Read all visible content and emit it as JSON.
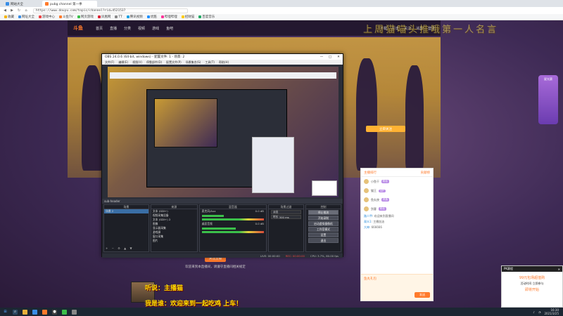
{
  "browser": {
    "tabs": [
      {
        "label": "网站大全"
      },
      {
        "label": "pubg channel 第一季"
      }
    ],
    "url": "https://www.douyu.com/topic/channel?rid=4521537",
    "bookmarks": [
      "收藏",
      "网址大全",
      "游戏中心",
      "斗鱼TV",
      "网页游戏",
      "凤凰网",
      "TT",
      "腾讯视频",
      "优酷",
      "哔哩哔哩",
      "招财猫",
      "百度音乐"
    ]
  },
  "site": {
    "logo": "斗鱼",
    "nav": [
      "首页",
      "直播",
      "分类",
      "视频",
      "游戏",
      "鱼吧"
    ],
    "header_right": [
      "下载",
      "历史",
      "关注",
      "消息",
      "登录"
    ],
    "banner_text": "上周猫喵头推哦第一人名言"
  },
  "obs": {
    "title": "OBS 24.0.6 (64-bit, windows) - 配置文件: 1 - 场景: 2",
    "menu": [
      "文件(F)",
      "编辑(E)",
      "视图(V)",
      "停靠部件(D)",
      "配置文件(P)",
      "场景集合(S)",
      "工具(T)",
      "帮助(H)"
    ],
    "dock_header_items": [
      "sub-header",
      "混音器",
      "场景"
    ],
    "scenes": {
      "title": "场景",
      "items": [
        "场景 2"
      ]
    },
    "sources": {
      "title": "来源",
      "items": [
        "文本 (GDI+)",
        "视频采集设备",
        "文本 (GDI+) 2",
        "图像",
        "显示器采集",
        "游戏源",
        "窗口采集",
        "图片"
      ]
    },
    "mixer": {
      "title": "混音器",
      "channels": [
        {
          "name": "麦克风/Aux",
          "db": "0.0 dB",
          "level": 0.35
        },
        {
          "name": "桌面音频",
          "db": "0.0 dB",
          "level": 0.55
        }
      ]
    },
    "transitions": {
      "title": "场景过渡",
      "type": "淡出",
      "duration_label": "时长",
      "duration": "300 ms"
    },
    "controls": {
      "title": "控制",
      "buttons": [
        "停止推流",
        "开始录制",
        "启动虚拟摄像机",
        "工作室模式",
        "设置",
        "退出"
      ]
    },
    "status": {
      "live": "LIVE: 00:00:00",
      "rec": "REC: 00:00:00",
      "cpu": "CPU: 3.7%, 60.00 fps"
    }
  },
  "panel": {
    "header_left": "主播排行",
    "header_right": "贡献榜",
    "rows": [
      {
        "name": "小鱼干",
        "tag": "粉丝"
      },
      {
        "name": "猫王",
        "tag": "VIP"
      },
      {
        "name": "鱼丸侠",
        "tag": "贵族"
      },
      {
        "name": "剑客",
        "tag": "粉丝"
      }
    ],
    "chat": [
      {
        "user": "路人甲",
        "text": "欢迎来到直播间"
      },
      {
        "user": "观众1",
        "text": "主播加油"
      },
      {
        "user": "大神",
        "text": "666666"
      }
    ],
    "gift_title": "鱼丸礼包",
    "send": "发送"
  },
  "rank_widget": {
    "label": "星光赛"
  },
  "yellow_button": "立即关注",
  "bottom": {
    "follow": "关注主播",
    "sub": "欢迎来到本直播间，请遵守直播间相关规定"
  },
  "danmu": [
    "听说：主播猫",
    "我是谁：欢迎来到一起吃鸡 上车！"
  ],
  "popup": {
    "title": "PK赛程",
    "line1": "99元包场超值购",
    "line2": "活动时间 立即参与",
    "big": "即将开始"
  },
  "taskbar": {
    "time": "16:30",
    "date": "2021/3/25"
  }
}
